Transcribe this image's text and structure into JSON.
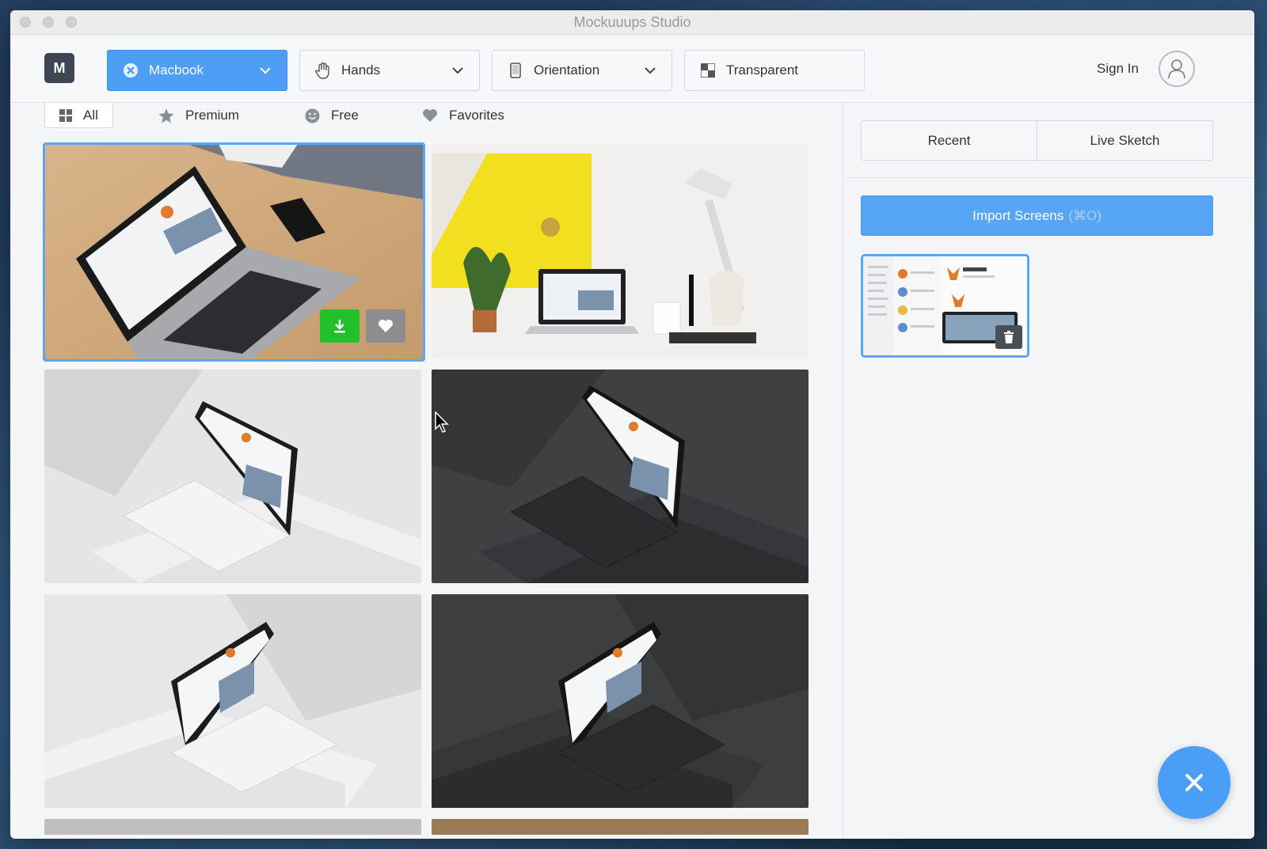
{
  "window": {
    "title": "Mockuuups Studio"
  },
  "toolbar": {
    "logo": "M",
    "device_dropdown": "Macbook",
    "hands_dropdown": "Hands",
    "orientation_dropdown": "Orientation",
    "background_toggle": "Transparent",
    "sign_in": "Sign In"
  },
  "filters": {
    "all": "All",
    "premium": "Premium",
    "free": "Free",
    "favorites": "Favorites"
  },
  "sidebar": {
    "tabs": [
      "Recent",
      "Live Sketch"
    ],
    "import_label": "Import Screens",
    "import_shortcut": "(⌘O)"
  },
  "colors": {
    "accent": "#4d9ef4",
    "download": "#22c02b"
  },
  "mockups": [
    {
      "name": "Laptop on wooden desk",
      "theme": "wood",
      "selected": true
    },
    {
      "name": "Laptop on white desk with yellow pegboard",
      "theme": "yellow"
    },
    {
      "name": "Isometric laptop light",
      "theme": "light"
    },
    {
      "name": "Isometric laptop dark",
      "theme": "dark"
    },
    {
      "name": "Isometric laptop light left",
      "theme": "light"
    },
    {
      "name": "Isometric laptop dark left",
      "theme": "dark"
    }
  ]
}
